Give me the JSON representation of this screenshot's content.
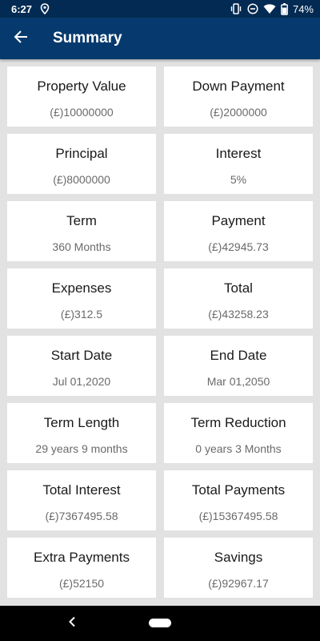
{
  "status_bar": {
    "time": "6:27",
    "battery": "74%"
  },
  "app_bar": {
    "title": "Summary"
  },
  "summary": {
    "items": [
      {
        "label": "Property Value",
        "value": "(£)10000000"
      },
      {
        "label": "Down Payment",
        "value": "(£)2000000"
      },
      {
        "label": "Principal",
        "value": "(£)8000000"
      },
      {
        "label": "Interest",
        "value": "5%"
      },
      {
        "label": "Term",
        "value": "360 Months"
      },
      {
        "label": "Payment",
        "value": "(£)42945.73"
      },
      {
        "label": "Expenses",
        "value": "(£)312.5"
      },
      {
        "label": "Total",
        "value": "(£)43258.23"
      },
      {
        "label": "Start Date",
        "value": "Jul 01,2020"
      },
      {
        "label": "End Date",
        "value": "Mar 01,2050"
      },
      {
        "label": "Term Length",
        "value": "29 years 9 months"
      },
      {
        "label": "Term Reduction",
        "value": "0 years 3 Months"
      },
      {
        "label": "Total Interest",
        "value": "(£)7367495.58"
      },
      {
        "label": "Total Payments",
        "value": "(£)15367495.58"
      },
      {
        "label": "Extra Payments",
        "value": "(£)52150"
      },
      {
        "label": "Savings",
        "value": "(£)92967.17"
      }
    ]
  },
  "colors": {
    "status_bar": "#022a52",
    "app_bar": "#063a6e",
    "background": "#e2e2e2",
    "card": "#ffffff"
  },
  "icons": {
    "back": "arrow-left-icon",
    "location": "location-pin-icon",
    "vibrate": "vibrate-icon",
    "dnd": "do-not-disturb-icon",
    "wifi": "wifi-icon",
    "battery": "battery-icon"
  }
}
